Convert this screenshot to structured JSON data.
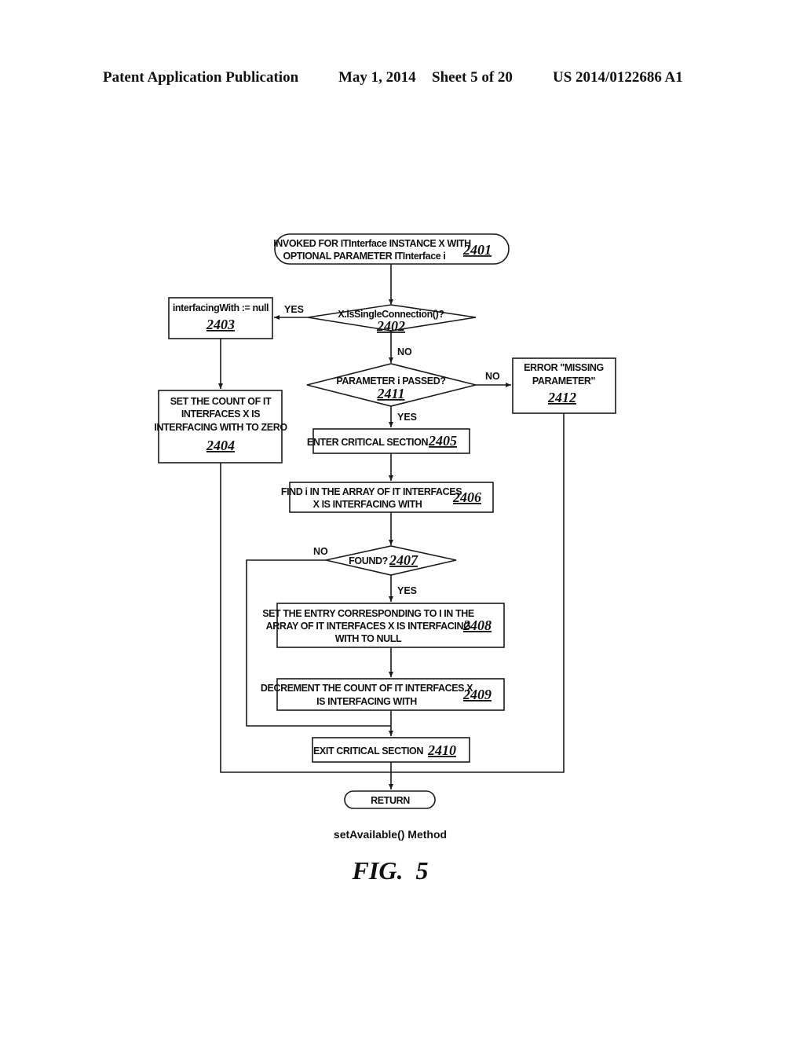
{
  "header": {
    "publication": "Patent Application Publication",
    "date": "May 1, 2014",
    "sheet": "Sheet 5 of 20",
    "number": "US 2014/0122686 A1"
  },
  "flowchart": {
    "nodes": {
      "n2401": {
        "lines": [
          "INVOKED FOR ITInterface INSTANCE X WITH",
          "OPTIONAL PARAMETER  ITInterface i"
        ],
        "ref": "2401",
        "shape": "terminal"
      },
      "n2402": {
        "lines": [
          "X.isSingleConnection()?"
        ],
        "ref": "2402",
        "shape": "decision"
      },
      "n2403": {
        "lines": [
          "interfacingWith := null"
        ],
        "ref": "2403",
        "shape": "process"
      },
      "n2404": {
        "lines": [
          "SET THE COUNT OF IT",
          "INTERFACES X IS",
          "INTERFACING WITH TO ZERO"
        ],
        "ref": "2404",
        "shape": "process"
      },
      "n2411": {
        "lines": [
          "PARAMETER i PASSED?"
        ],
        "ref": "2411",
        "shape": "decision"
      },
      "n2412": {
        "lines": [
          "ERROR \"MISSING",
          "PARAMETER\""
        ],
        "ref": "2412",
        "shape": "process"
      },
      "n2405": {
        "lines": [
          "ENTER CRITICAL SECTION"
        ],
        "ref": "2405",
        "shape": "process"
      },
      "n2406": {
        "lines": [
          "FIND i IN THE ARRAY OF IT INTERFACES",
          "X IS INTERFACING WITH"
        ],
        "ref": "2406",
        "shape": "process"
      },
      "n2407": {
        "lines": [
          "FOUND?"
        ],
        "ref": "2407",
        "shape": "decision"
      },
      "n2408": {
        "lines": [
          "SET THE ENTRY CORRESPONDING TO I IN THE",
          "ARRAY OF IT INTERFACES X IS INTERFACING",
          "WITH TO NULL"
        ],
        "ref": "2408",
        "shape": "process"
      },
      "n2409": {
        "lines": [
          "DECREMENT THE COUNT OF IT INTERFACES X",
          "IS INTERFACING WITH"
        ],
        "ref": "2409",
        "shape": "process"
      },
      "n2410": {
        "lines": [
          "EXIT CRITICAL SECTION"
        ],
        "ref": "2410",
        "shape": "process"
      },
      "return": {
        "lines": [
          "RETURN"
        ],
        "ref": "",
        "shape": "terminal"
      }
    },
    "edge_labels": {
      "yes_2402": "YES",
      "no_2402": "NO",
      "no_2411": "NO",
      "yes_2411": "YES",
      "no_2407": "NO",
      "yes_2407": "YES"
    }
  },
  "caption": "setAvailable() Method",
  "figure_label": "FIG.  5"
}
